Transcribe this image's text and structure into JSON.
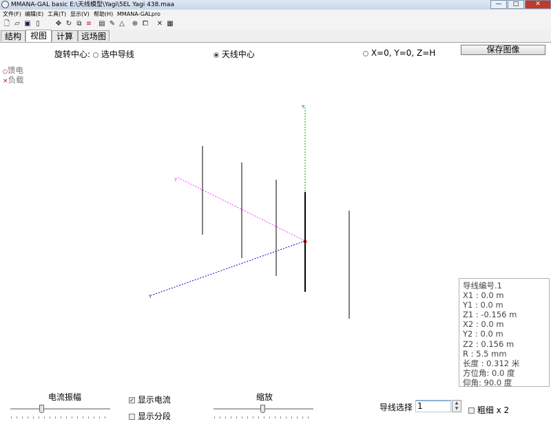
{
  "window": {
    "title": "MMANA-GAL basic E:\\天线模型\\Yagi\\5EL Yagi 438.maa",
    "min": "—",
    "max": "□",
    "close": "✕"
  },
  "menu": {
    "file": "文件(F)",
    "edit": "编辑(E)",
    "tools": "工具(T)",
    "view": "显示(V)",
    "help": "帮助(H)",
    "pro": "MMANA-GALpro"
  },
  "toolbar_icons": [
    "new-icon",
    "open-icon",
    "save-icon",
    "info-icon",
    "move-icon",
    "rotate-icon",
    "zoom-icon",
    "wire-icon",
    "page-icon",
    "edit-icon",
    "triangle-icon",
    "target-icon",
    "copy-icon",
    "tools-icon",
    "calculator-icon"
  ],
  "tabs": [
    "结构",
    "视图",
    "计算",
    "远场图"
  ],
  "active_tab": "视图",
  "rotation": {
    "label": "旋转中心:",
    "opt_selected_wire": "选中导线",
    "opt_antenna_center": "天线中心",
    "opt_origin": "X=0, Y=0, Z=H",
    "selected": "天线中心"
  },
  "save_image_label": "保存图像",
  "legend": {
    "feed": "馈电",
    "load": "负载",
    "feed_mark": "○",
    "load_mark": "×"
  },
  "colors": {
    "x_axis": "#0000cc",
    "y_axis": "#ff33ff",
    "z_axis": "#009900",
    "feed": "#cc0000",
    "element": "#000000"
  },
  "wire_info": {
    "number": "导线编号.1",
    "x1": "X1   :  0.0 m",
    "y1": "Y1   :  0.0 m",
    "z1": "Z1   :  -0.156 m",
    "x2": "X2   :  0.0 m",
    "y2": "Y2   :  0.0 m",
    "z2": "Z2   :  0.156 m",
    "r": "R    :  5.5 mm",
    "length": "长度 : 0.312 米",
    "azimuth": "方位角: 0.0 度",
    "elevation": "仰角: 90.0 度"
  },
  "controls": {
    "current_amplitude_label": "电流振幅",
    "show_current_label": "显示电流",
    "show_current_checked": true,
    "show_segments_label": "显示分段",
    "show_segments_checked": false,
    "zoom_label": "缩放",
    "wire_select_label": "导线选择",
    "wire_select_value": "1",
    "thick_label": "粗细 x 2",
    "thick_checked": false
  }
}
